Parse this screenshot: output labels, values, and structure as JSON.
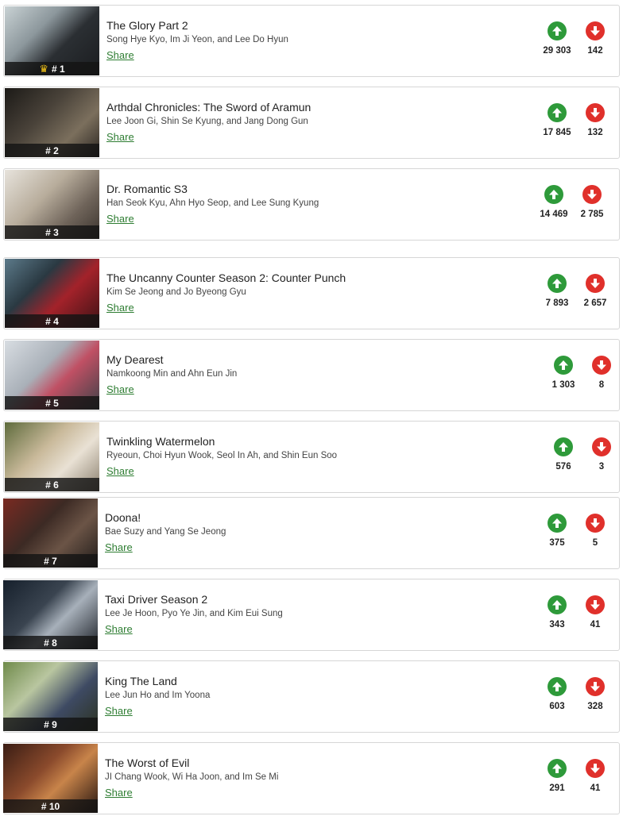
{
  "share_label": "Share",
  "colors": {
    "upvote": "#2e9a3a",
    "downvote": "#e0302b",
    "share_link": "#2e7d32"
  },
  "icons": {
    "up": "arrow-up-icon",
    "down": "arrow-down-icon",
    "crown": "crown-icon"
  },
  "items": [
    {
      "rank": "# 1",
      "title": "The Glory Part 2",
      "cast": "Song Hye Kyo, Im Ji Yeon, and Lee Do Hyun",
      "up": "29 303",
      "down": "142"
    },
    {
      "rank": "# 2",
      "title": "Arthdal Chronicles: The Sword of Aramun",
      "cast": "Lee Joon Gi, Shin Se Kyung, and Jang Dong Gun",
      "up": "17 845",
      "down": "132"
    },
    {
      "rank": "# 3",
      "title": "Dr. Romantic S3",
      "cast": "Han Seok Kyu, Ahn Hyo Seop, and Lee Sung Kyung",
      "up": "14 469",
      "down": "2 785"
    },
    {
      "rank": "# 4",
      "title": "The Uncanny Counter Season 2: Counter Punch",
      "cast": "Kim Se Jeong and Jo Byeong Gyu",
      "up": "7 893",
      "down": "2 657"
    },
    {
      "rank": "# 5",
      "title": "My Dearest",
      "cast": "Namkoong Min and Ahn Eun Jin",
      "up": "1 303",
      "down": "8"
    },
    {
      "rank": "# 6",
      "title": "Twinkling Watermelon",
      "cast": "Ryeoun, Choi Hyun Wook, Seol In Ah, and Shin Eun Soo",
      "up": "576",
      "down": "3"
    },
    {
      "rank": "# 7",
      "title": "Doona!",
      "cast": "Bae Suzy and Yang Se Jeong",
      "up": "375",
      "down": "5"
    },
    {
      "rank": "# 8",
      "title": "Taxi Driver Season 2",
      "cast": "Lee Je Hoon, Pyo Ye Jin, and Kim Eui Sung",
      "up": "343",
      "down": "41"
    },
    {
      "rank": "# 9",
      "title": "King The Land",
      "cast": "Lee Jun Ho and Im Yoona",
      "up": "603",
      "down": "328"
    },
    {
      "rank": "# 10",
      "title": "The Worst of Evil",
      "cast": "JI Chang Wook, Wi Ha Joon, and Im Se Mi",
      "up": "291",
      "down": "41"
    }
  ]
}
